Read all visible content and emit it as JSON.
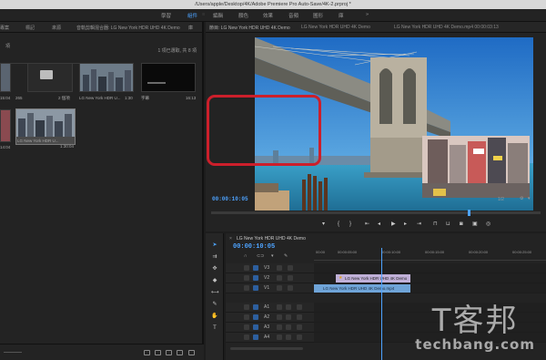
{
  "window": {
    "title": "/Users/apple/Desktop/4K/Adobe Premiere Pro Auto-Save/4K-2.prproj *"
  },
  "workspaces": [
    "學習",
    "組件",
    "編輯",
    "顏色",
    "效果",
    "音頻",
    "圖形",
    "庫"
  ],
  "active_workspace": "組件",
  "project_panel": {
    "tabs": [
      "專案",
      "標記",
      "來源",
      "音軌剪輯混合器: LG New York HDR UHD 4K Demo",
      "庫"
    ],
    "path_label": "項",
    "selection_info": "1 項已選取, 共 8 項",
    "items": [
      {
        "name": "",
        "duration": "15:04",
        "kind": "clip-partial"
      },
      {
        "name": "265",
        "duration": "",
        "kind": "folder"
      },
      {
        "name": "2 個項",
        "duration": "",
        "kind": "folder-count"
      },
      {
        "name": "LG New York HDR U...",
        "duration": "1:30",
        "kind": "clip"
      },
      {
        "name": "字幕",
        "duration": "16:13",
        "kind": "title"
      },
      {
        "name": "",
        "duration": "14:04",
        "kind": "clip-partial-2"
      },
      {
        "name": "LG New York HDR U...",
        "duration": "1:30:04",
        "kind": "clip-selected"
      }
    ]
  },
  "program_monitor": {
    "tabs": [
      "節目: LG New York HDR UHD 4K Demo",
      "LG New York HDR UHD 4K Demo",
      "LG New York HDR UHD 4K Demo.mp4 00:00:03:13"
    ],
    "timecode": "00:00:10:05",
    "resolution": "1/2",
    "pip_callout": "highlighted picture-in-picture clip"
  },
  "timeline": {
    "tab_label": "LG New York HDR UHD 4K Demo",
    "timecode": "00:00:10:05",
    "ruler_labels": [
      "00:00",
      "00:00:05:00",
      "00:00:10:00",
      "00:00:15:00",
      "00:00:20:00",
      "00:00:25:00"
    ],
    "video_tracks": [
      "V3",
      "V2",
      "V1"
    ],
    "audio_tracks": [
      "A1",
      "A2",
      "A3",
      "A4"
    ],
    "clips": [
      {
        "track": "V2",
        "label": "LG New York HDR UHD 4K Demo",
        "color": "#c0b0d8"
      },
      {
        "track": "V1",
        "label": "LG New York HDR UHD 4K Demo.mp4",
        "color": "#6fa4d8"
      }
    ]
  },
  "watermark": {
    "chinese": "T客邦",
    "english": "techbang.com"
  },
  "colors": {
    "accent": "#4da3ff",
    "callout": "#cc1f2b"
  }
}
